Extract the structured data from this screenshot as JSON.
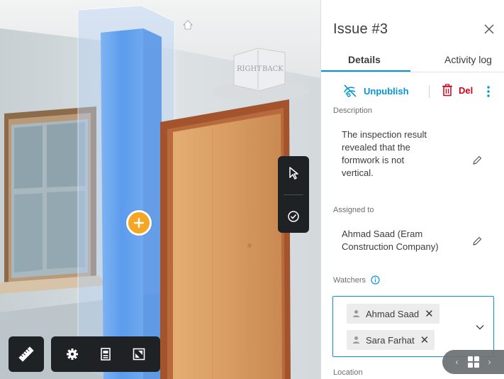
{
  "viewport": {
    "nav_cube": {
      "left_face": "RIGHT",
      "front_face": "BACK"
    },
    "toolbar_icons": [
      "ruler-icon",
      "gear-icon",
      "sheet-icon",
      "fullscreen-icon"
    ],
    "side_toolbar_icons": [
      "cursor-icon",
      "check-circle-icon"
    ],
    "pin_icon": "plus-icon",
    "colors": {
      "pin": "#f5a623",
      "column_highlight": "#6aa6f0",
      "door": "#d9a06a",
      "toolbar": "#1f2225"
    }
  },
  "panel": {
    "title": "Issue #3",
    "tabs": [
      {
        "label": "Details",
        "active": true
      },
      {
        "label": "Activity log",
        "active": false
      }
    ],
    "actions": {
      "unpublish_label": "Unpublish",
      "delete_label": "Del"
    },
    "description": {
      "label": "Description",
      "lines": [
        "The inspection result",
        "revealed that the",
        "formwork is not",
        "vertical."
      ]
    },
    "assigned_to": {
      "label": "Assigned to",
      "lines": [
        "Ahmad Saad (Eram",
        "Construction Company)"
      ]
    },
    "watchers": {
      "label": "Watchers",
      "items": [
        "Ahmad Saad",
        "Sara Farhat"
      ]
    },
    "location": {
      "label": "Location"
    },
    "colors": {
      "accent": "#0696d7",
      "danger": "#d0021b"
    }
  }
}
